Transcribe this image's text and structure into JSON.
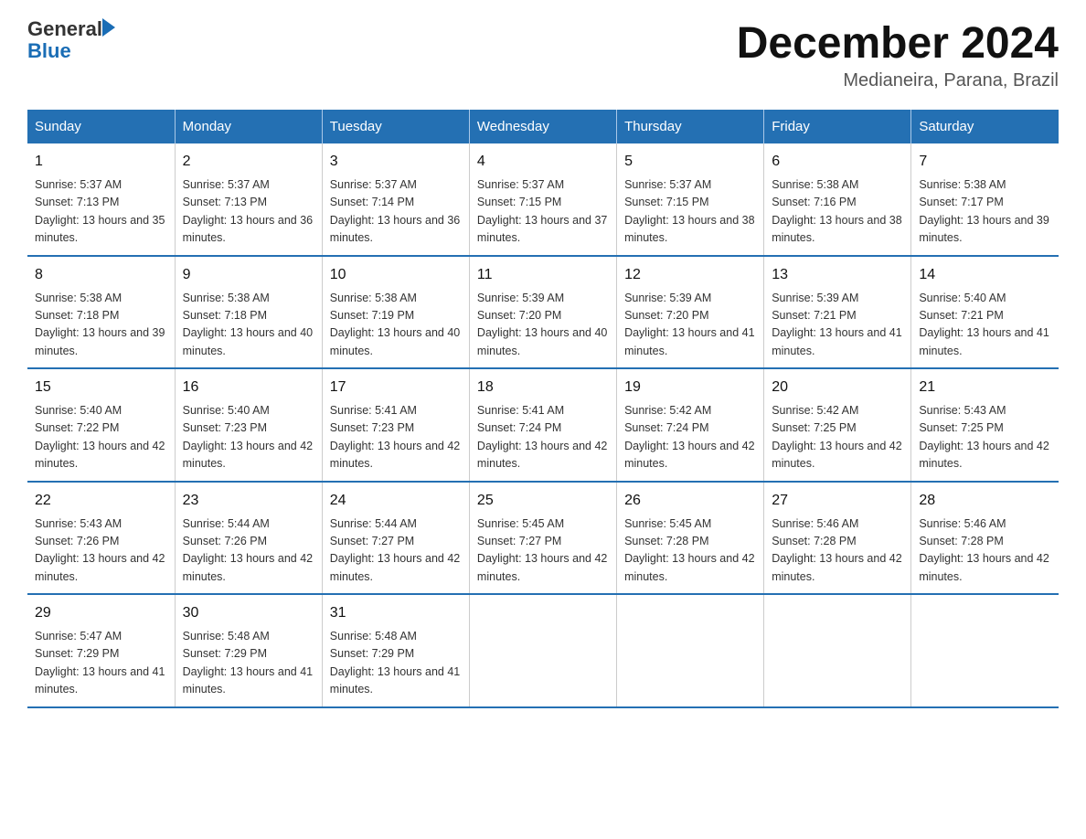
{
  "logo": {
    "general": "General",
    "blue": "Blue"
  },
  "title": "December 2024",
  "location": "Medianeira, Parana, Brazil",
  "headers": [
    "Sunday",
    "Monday",
    "Tuesday",
    "Wednesday",
    "Thursday",
    "Friday",
    "Saturday"
  ],
  "weeks": [
    [
      {
        "day": "1",
        "sunrise": "5:37 AM",
        "sunset": "7:13 PM",
        "daylight": "13 hours and 35 minutes."
      },
      {
        "day": "2",
        "sunrise": "5:37 AM",
        "sunset": "7:13 PM",
        "daylight": "13 hours and 36 minutes."
      },
      {
        "day": "3",
        "sunrise": "5:37 AM",
        "sunset": "7:14 PM",
        "daylight": "13 hours and 36 minutes."
      },
      {
        "day": "4",
        "sunrise": "5:37 AM",
        "sunset": "7:15 PM",
        "daylight": "13 hours and 37 minutes."
      },
      {
        "day": "5",
        "sunrise": "5:37 AM",
        "sunset": "7:15 PM",
        "daylight": "13 hours and 38 minutes."
      },
      {
        "day": "6",
        "sunrise": "5:38 AM",
        "sunset": "7:16 PM",
        "daylight": "13 hours and 38 minutes."
      },
      {
        "day": "7",
        "sunrise": "5:38 AM",
        "sunset": "7:17 PM",
        "daylight": "13 hours and 39 minutes."
      }
    ],
    [
      {
        "day": "8",
        "sunrise": "5:38 AM",
        "sunset": "7:18 PM",
        "daylight": "13 hours and 39 minutes."
      },
      {
        "day": "9",
        "sunrise": "5:38 AM",
        "sunset": "7:18 PM",
        "daylight": "13 hours and 40 minutes."
      },
      {
        "day": "10",
        "sunrise": "5:38 AM",
        "sunset": "7:19 PM",
        "daylight": "13 hours and 40 minutes."
      },
      {
        "day": "11",
        "sunrise": "5:39 AM",
        "sunset": "7:20 PM",
        "daylight": "13 hours and 40 minutes."
      },
      {
        "day": "12",
        "sunrise": "5:39 AM",
        "sunset": "7:20 PM",
        "daylight": "13 hours and 41 minutes."
      },
      {
        "day": "13",
        "sunrise": "5:39 AM",
        "sunset": "7:21 PM",
        "daylight": "13 hours and 41 minutes."
      },
      {
        "day": "14",
        "sunrise": "5:40 AM",
        "sunset": "7:21 PM",
        "daylight": "13 hours and 41 minutes."
      }
    ],
    [
      {
        "day": "15",
        "sunrise": "5:40 AM",
        "sunset": "7:22 PM",
        "daylight": "13 hours and 42 minutes."
      },
      {
        "day": "16",
        "sunrise": "5:40 AM",
        "sunset": "7:23 PM",
        "daylight": "13 hours and 42 minutes."
      },
      {
        "day": "17",
        "sunrise": "5:41 AM",
        "sunset": "7:23 PM",
        "daylight": "13 hours and 42 minutes."
      },
      {
        "day": "18",
        "sunrise": "5:41 AM",
        "sunset": "7:24 PM",
        "daylight": "13 hours and 42 minutes."
      },
      {
        "day": "19",
        "sunrise": "5:42 AM",
        "sunset": "7:24 PM",
        "daylight": "13 hours and 42 minutes."
      },
      {
        "day": "20",
        "sunrise": "5:42 AM",
        "sunset": "7:25 PM",
        "daylight": "13 hours and 42 minutes."
      },
      {
        "day": "21",
        "sunrise": "5:43 AM",
        "sunset": "7:25 PM",
        "daylight": "13 hours and 42 minutes."
      }
    ],
    [
      {
        "day": "22",
        "sunrise": "5:43 AM",
        "sunset": "7:26 PM",
        "daylight": "13 hours and 42 minutes."
      },
      {
        "day": "23",
        "sunrise": "5:44 AM",
        "sunset": "7:26 PM",
        "daylight": "13 hours and 42 minutes."
      },
      {
        "day": "24",
        "sunrise": "5:44 AM",
        "sunset": "7:27 PM",
        "daylight": "13 hours and 42 minutes."
      },
      {
        "day": "25",
        "sunrise": "5:45 AM",
        "sunset": "7:27 PM",
        "daylight": "13 hours and 42 minutes."
      },
      {
        "day": "26",
        "sunrise": "5:45 AM",
        "sunset": "7:28 PM",
        "daylight": "13 hours and 42 minutes."
      },
      {
        "day": "27",
        "sunrise": "5:46 AM",
        "sunset": "7:28 PM",
        "daylight": "13 hours and 42 minutes."
      },
      {
        "day": "28",
        "sunrise": "5:46 AM",
        "sunset": "7:28 PM",
        "daylight": "13 hours and 42 minutes."
      }
    ],
    [
      {
        "day": "29",
        "sunrise": "5:47 AM",
        "sunset": "7:29 PM",
        "daylight": "13 hours and 41 minutes."
      },
      {
        "day": "30",
        "sunrise": "5:48 AM",
        "sunset": "7:29 PM",
        "daylight": "13 hours and 41 minutes."
      },
      {
        "day": "31",
        "sunrise": "5:48 AM",
        "sunset": "7:29 PM",
        "daylight": "13 hours and 41 minutes."
      },
      null,
      null,
      null,
      null
    ]
  ],
  "colors": {
    "header_bg": "#2470b3",
    "header_text": "#ffffff",
    "border_blue": "#2470b3",
    "cell_border": "#cccccc"
  }
}
